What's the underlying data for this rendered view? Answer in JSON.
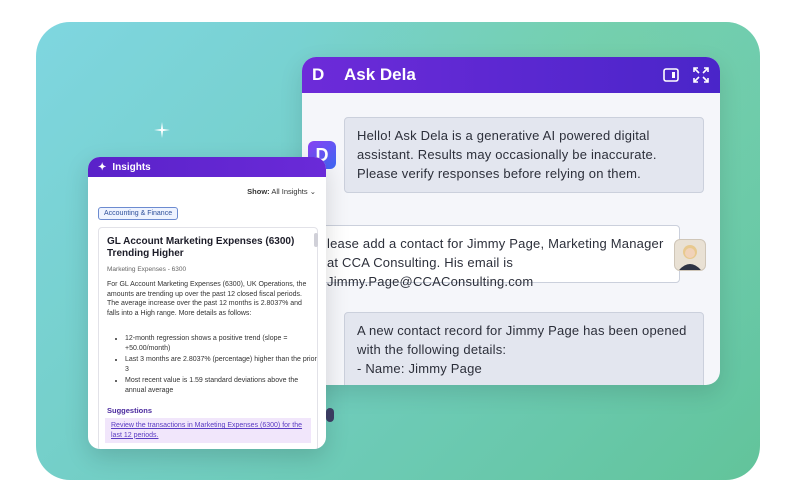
{
  "dela": {
    "logo": "D",
    "title": "Ask Dela",
    "messages": [
      {
        "from": "assistant",
        "text": "Hello! Ask Dela is a generative AI powered digital assistant. Results may occasionally be inaccurate. Please verify responses before relying on them."
      },
      {
        "from": "user",
        "text": "lease add a contact for Jimmy Page, Marketing Manager at CCA Consulting. His email is Jimmy.Page@CCAConsulting.com"
      },
      {
        "from": "assistant",
        "text": "A new contact record for Jimmy Page has been opened with the following details:\n- Name: Jimmy Page"
      }
    ],
    "bot_avatar": "D"
  },
  "insights": {
    "title": "Insights",
    "show_label": "Show:",
    "show_value": "All Insights",
    "tag": "Accounting & Finance",
    "card": {
      "title": "GL Account Marketing Expenses (6300) Trending Higher",
      "subtitle": "Marketing Expenses - 6300",
      "body": "For GL Account Marketing Expenses (6300), UK Operations, the amounts are trending up over the past 12 closed fiscal periods. The average increase over the past 12 months is 2.8037% and falls into a High range. More details as follows:",
      "bullets": [
        "12-month regression shows a positive trend (slope = +50.00/month)",
        "Last 3 months are 2.8037% (percentage) higher than the prior 3",
        "Most recent value is 1.59 standard deviations above the annual average"
      ],
      "suggestions_label": "Suggestions",
      "suggestion_link": "Review the transactions in Marketing Expenses (6300) for the last 12 periods."
    }
  },
  "colors": {
    "header_purple": "#6d2bd9",
    "bubble_bg": "#e3e6ef",
    "stage_teal": "#74cfc8"
  }
}
